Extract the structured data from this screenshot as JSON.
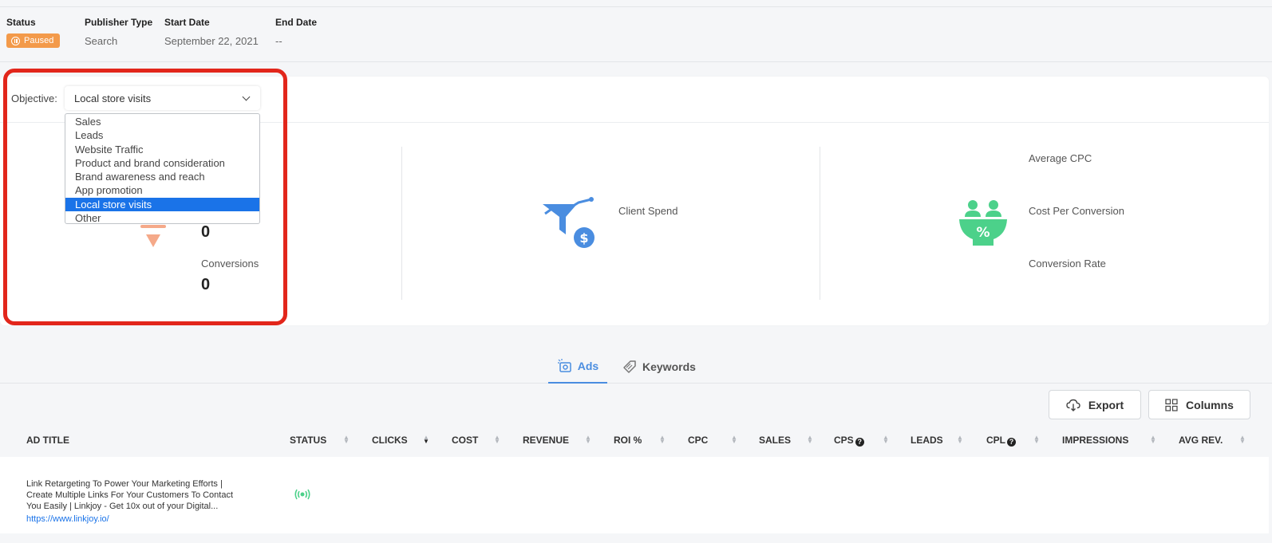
{
  "meta": {
    "status_label": "Status",
    "status_value": "Paused",
    "publisher_type_label": "Publisher Type",
    "publisher_type_value": "Search",
    "start_date_label": "Start Date",
    "start_date_value": "September 22, 2021",
    "end_date_label": "End Date",
    "end_date_value": "--"
  },
  "objective": {
    "label": "Objective:",
    "selected": "Local store visits",
    "options": [
      "Sales",
      "Leads",
      "Website Traffic",
      "Product and brand consideration",
      "Brand awareness and reach",
      "App promotion",
      "Local store visits",
      "Other"
    ]
  },
  "stats": {
    "metric_value_1": "0",
    "conversions_label": "Conversions",
    "conversions_value": "0",
    "client_spend_label": "Client Spend",
    "avg_cpc_label": "Average CPC",
    "cost_per_conversion_label": "Cost Per Conversion",
    "conversion_rate_label": "Conversion Rate"
  },
  "tabs": [
    {
      "label": "Ads",
      "icon": "ad-icon",
      "active": true
    },
    {
      "label": "Keywords",
      "icon": "tag-icon",
      "active": false
    }
  ],
  "toolbar": {
    "export_label": "Export",
    "columns_label": "Columns"
  },
  "table": {
    "columns": [
      "AD TITLE",
      "STATUS",
      "CLICKS",
      "COST",
      "REVENUE",
      "ROI %",
      "CPC",
      "SALES",
      "CPS",
      "LEADS",
      "CPL",
      "IMPRESSIONS",
      "AVG REV."
    ],
    "rows": [
      {
        "ad_title": "Link Retargeting To Power Your Marketing Efforts | Create Multiple Links For Your Customers To Contact You Easily | Linkjoy - Get 10x out of your Digital...",
        "url": "https://www.linkjoy.io/",
        "status_icon": "broadcast-icon"
      }
    ]
  },
  "colors": {
    "accent": "#4a8de0",
    "paused": "#f39a4a",
    "selected_option": "#1a73e8",
    "highlight": "#e2261b",
    "active_green": "#4cd18a"
  }
}
